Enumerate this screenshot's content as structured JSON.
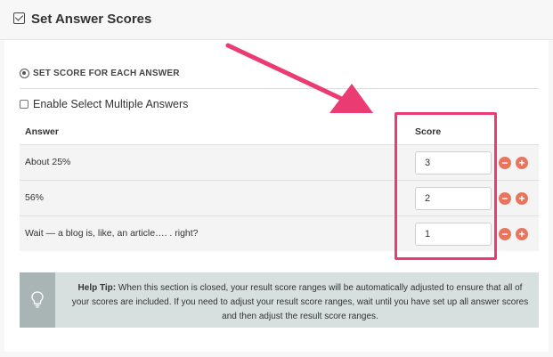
{
  "header": {
    "title": "Set Answer Scores"
  },
  "section": {
    "title": "SET SCORE FOR EACH ANSWER"
  },
  "options": {
    "multiple_label": "Enable Select Multiple Answers",
    "multiple_checked": false
  },
  "table": {
    "col_answer": "Answer",
    "col_score": "Score",
    "rows": [
      {
        "answer": "About 25%",
        "score": "3"
      },
      {
        "answer": "56%",
        "score": "2"
      },
      {
        "answer": "Wait — a blog is, like, an article…. .  right?",
        "score": "1"
      }
    ],
    "minus_symbol": "−",
    "plus_symbol": "+"
  },
  "tip": {
    "label": "Help Tip:",
    "text": " When this section is closed, your result score ranges will be automatically adjusted to ensure that all of your scores are included. If you need to adjust your result score ranges, wait until you have set up all answer scores and then adjust the result score ranges."
  },
  "colors": {
    "accent_pink": "#ea3b73",
    "button_orange": "#e8765f",
    "tip_bg": "#d8dfdf",
    "tip_icon_bg": "#a9b4b4"
  }
}
